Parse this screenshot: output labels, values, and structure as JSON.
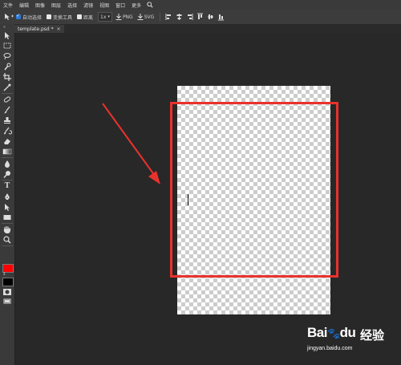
{
  "menu": [
    "文件",
    "编辑",
    "图像",
    "图层",
    "选择",
    "滤镜",
    "视图",
    "窗口",
    "更多"
  ],
  "options": {
    "auto_select": "自动选择",
    "transform": "变换工具",
    "distance": "距离",
    "zoom": "1x",
    "png": "PNG",
    "svg": "SVG"
  },
  "tab": {
    "label": "template.psd *",
    "close": "✕"
  },
  "toolbar": {
    "tools": [
      "move-tool",
      "marquee-tool",
      "lasso-tool",
      "quick-select-tool",
      "crop-tool",
      "eyedropper-tool",
      "healing-tool",
      "brush-tool",
      "stamp-tool",
      "history-brush-tool",
      "eraser-tool",
      "gradient-tool",
      "blur-tool",
      "dodge-tool",
      "type-tool",
      "pen-tool",
      "path-select-tool",
      "shape-tool",
      "hand-tool",
      "zoom-tool"
    ],
    "type_glyph": "T",
    "fg_color": "#ff0000",
    "bg_color": "#000000"
  },
  "colors": {
    "annotation": "#e8322d"
  },
  "watermark": {
    "brand": "Bai",
    "brand_du": "du",
    "brand_cn": "经验",
    "url": "jingyan.baidu.com"
  }
}
